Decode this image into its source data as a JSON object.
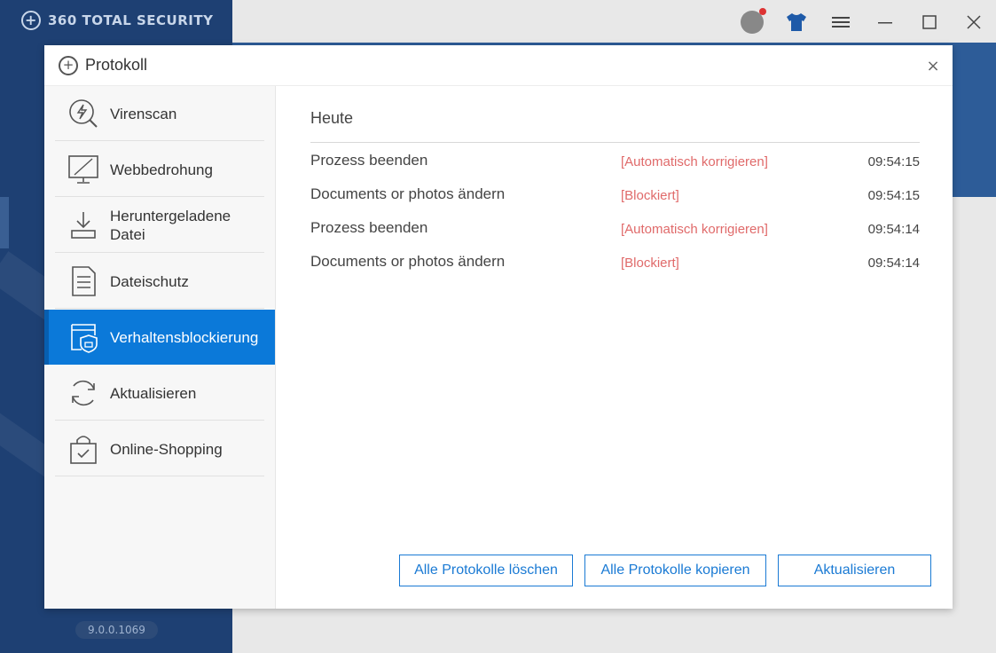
{
  "app": {
    "logo_text": "360 TOTAL SECURITY",
    "version": "9.0.0.1069"
  },
  "dialog": {
    "title": "Protokoll",
    "close_label": "×"
  },
  "sidebar": {
    "items": [
      {
        "label": "Virenscan",
        "icon": "virus-scan-icon",
        "active": false
      },
      {
        "label": "Webbedrohung",
        "icon": "web-threat-icon",
        "active": false
      },
      {
        "label": "Heruntergeladene Datei",
        "icon": "download-icon",
        "active": false
      },
      {
        "label": "Dateischutz",
        "icon": "document-icon",
        "active": false
      },
      {
        "label": "Verhaltensblockierung",
        "icon": "behavior-shield-icon",
        "active": true
      },
      {
        "label": "Aktualisieren",
        "icon": "refresh-icon",
        "active": false
      },
      {
        "label": "Online-Shopping",
        "icon": "shopping-bag-icon",
        "active": false
      }
    ]
  },
  "content": {
    "section_title": "Heute",
    "rows": [
      {
        "name": "Prozess beenden",
        "status": "[Automatisch korrigieren]",
        "time": "09:54:15"
      },
      {
        "name": "Documents or photos ändern",
        "status": "[Blockiert]",
        "time": "09:54:15"
      },
      {
        "name": "Prozess beenden",
        "status": "[Automatisch korrigieren]",
        "time": "09:54:14"
      },
      {
        "name": "Documents or photos ändern",
        "status": "[Blockiert]",
        "time": "09:54:14"
      }
    ]
  },
  "buttons": {
    "clear_all": "Alle Protokolle löschen",
    "copy_all": "Alle Protokolle kopieren",
    "refresh": "Aktualisieren"
  },
  "colors": {
    "accent": "#0b79d9",
    "status_red": "#e06a6a",
    "sidebar_bg": "#1e4073"
  }
}
